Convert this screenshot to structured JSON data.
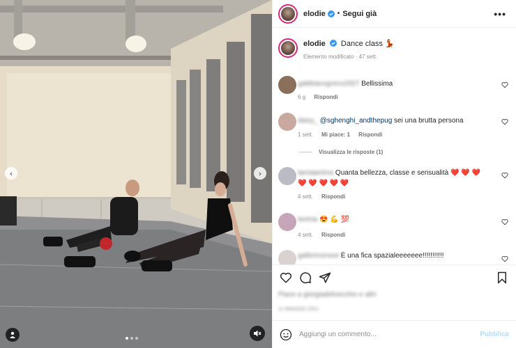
{
  "post": {
    "username": "elodie",
    "verified": true,
    "follow_label": "Segui già",
    "more_label": "•••"
  },
  "caption": {
    "username": "elodie",
    "text": "Dance class 💃",
    "meta": "Elemento modificato · 47 sett."
  },
  "comments": [
    {
      "username": "gabbianogreco2007",
      "text": "Bellissima",
      "time": "6 g",
      "reply_label": "Rispondi",
      "avatar_color": "#8a6f5a"
    },
    {
      "username": "daisy_",
      "mention": "@sghenghi_andthepug",
      "text": " sei una brutta persona",
      "time": "1 sett.",
      "likes_label": "Mi piace: 1",
      "reply_label": "Rispondi",
      "avatar_color": "#c9a8a0",
      "view_replies": "Visualizza le risposte (1)"
    },
    {
      "username": "lamiaanima",
      "text": "Quanta bellezza, classe e sensualità ❤️ ❤️ ❤️ ❤️ ❤️ ❤️ ❤️ ❤️",
      "time": "4 sett.",
      "reply_label": "Rispondi",
      "avatar_color": "#b9bcc4"
    },
    {
      "username": "lavinia",
      "text": "😍 💪 💯",
      "time": "4 sett.",
      "reply_label": "Rispondi",
      "avatar_color": "#c7a5b8"
    },
    {
      "username": "gallerinorossi",
      "text": "È una fica spazialeeeeeee!!!!!!!!!!!",
      "avatar_color": "#d9d2d0"
    }
  ],
  "likes_text": "Piace a giorgiadelvecchio e altri",
  "date_text": "11 MAGGIO 2021",
  "add_comment": {
    "placeholder": "Aggiungi un commento...",
    "publish_label": "Pubblica"
  },
  "media": {
    "prev_label": "‹",
    "next_label": "›"
  },
  "colors": {
    "story_ring": "#d62976",
    "verified": "#3897f0",
    "publish_disabled": "#b2dffc",
    "meta_gray": "#8e8e8e"
  }
}
